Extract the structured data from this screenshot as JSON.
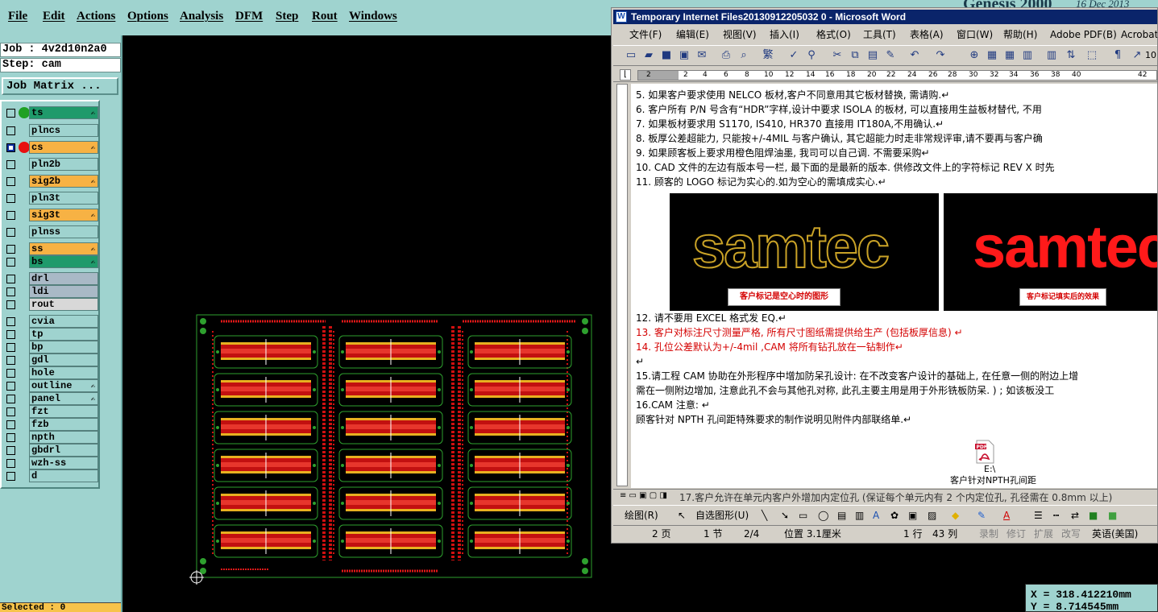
{
  "menubar": {
    "items": [
      "File",
      "Edit",
      "Actions",
      "Options",
      "Analysis",
      "DFM",
      "Step",
      "Rout",
      "Windows"
    ]
  },
  "genesis": {
    "title": "Genesis 2000",
    "date": "16 Dec 2013"
  },
  "panel": {
    "job": "Job : 4v2d10n2a0",
    "step": "Step: cam",
    "job_matrix": "Job Matrix ...",
    "layers": [
      {
        "name": "ts",
        "color": "#1f9a6b",
        "dot": "#1fa023",
        "checked": false,
        "edit": true
      },
      {
        "name": "plncs",
        "color": "#9fd3cf",
        "dot": "",
        "checked": false,
        "edit": false
      },
      {
        "name": "cs",
        "color": "#f7b244",
        "dot": "#e81010",
        "checked": true,
        "edit": true
      },
      {
        "name": "pln2b",
        "color": "#9fd3cf",
        "dot": "",
        "checked": false,
        "edit": false
      },
      {
        "name": "sig2b",
        "color": "#f7b244",
        "dot": "",
        "checked": false,
        "edit": true
      },
      {
        "name": "pln3t",
        "color": "#9fd3cf",
        "dot": "",
        "checked": false,
        "edit": false
      },
      {
        "name": "sig3t",
        "color": "#f7b244",
        "dot": "",
        "checked": false,
        "edit": true
      },
      {
        "name": "plnss",
        "color": "#9fd3cf",
        "dot": "",
        "checked": false,
        "edit": false
      },
      {
        "name": "ss",
        "color": "#f7b244",
        "dot": "",
        "checked": false,
        "edit": true
      },
      {
        "name": "bs",
        "color": "#1f9a6b",
        "dot": "",
        "checked": false,
        "edit": true
      },
      {
        "name": "drl",
        "color": "#a9b9c6",
        "dot": "",
        "checked": false,
        "edit": false
      },
      {
        "name": "ldi",
        "color": "#a9b9c6",
        "dot": "",
        "checked": false,
        "edit": false
      },
      {
        "name": "rout",
        "color": "#d8d8d8",
        "dot": "",
        "checked": false,
        "edit": false
      },
      {
        "name": "cvia",
        "color": "#9fd3cf",
        "dot": "",
        "checked": false,
        "edit": false
      },
      {
        "name": "tp",
        "color": "#9fd3cf",
        "dot": "",
        "checked": false,
        "edit": false
      },
      {
        "name": "bp",
        "color": "#9fd3cf",
        "dot": "",
        "checked": false,
        "edit": false
      },
      {
        "name": "gdl",
        "color": "#9fd3cf",
        "dot": "",
        "checked": false,
        "edit": false
      },
      {
        "name": "hole",
        "color": "#9fd3cf",
        "dot": "",
        "checked": false,
        "edit": false
      },
      {
        "name": "outline",
        "color": "#9fd3cf",
        "dot": "",
        "checked": false,
        "edit": true
      },
      {
        "name": "panel",
        "color": "#9fd3cf",
        "dot": "",
        "checked": false,
        "edit": true
      },
      {
        "name": "fzt",
        "color": "#9fd3cf",
        "dot": "",
        "checked": false,
        "edit": false
      },
      {
        "name": "fzb",
        "color": "#9fd3cf",
        "dot": "",
        "checked": false,
        "edit": false
      },
      {
        "name": "npth",
        "color": "#9fd3cf",
        "dot": "",
        "checked": false,
        "edit": false
      },
      {
        "name": "gbdrl",
        "color": "#9fd3cf",
        "dot": "",
        "checked": false,
        "edit": false
      },
      {
        "name": "wzh-ss",
        "color": "#9fd3cf",
        "dot": "",
        "checked": false,
        "edit": false
      },
      {
        "name": "d",
        "color": "#9fd3cf",
        "dot": "",
        "checked": false,
        "edit": false
      }
    ],
    "selected": "Selected : 0"
  },
  "coords": {
    "x": "X = 318.412210mm",
    "y": "Y = 8.714545mm"
  },
  "word": {
    "title": "Temporary Internet Files20130912205032 0 - Microsoft Word",
    "menu": [
      "文件(F)",
      "编辑(E)",
      "视图(V)",
      "插入(I)",
      "格式(O)",
      "工具(T)",
      "表格(A)",
      "窗口(W)",
      "帮助(H)",
      "Adobe PDF(B)",
      "Acrobat"
    ],
    "ruler_numbers": [
      "2",
      "2",
      "4",
      "6",
      "8",
      "10",
      "12",
      "14",
      "16",
      "18",
      "20",
      "22",
      "24",
      "26",
      "28",
      "30",
      "32",
      "34",
      "36",
      "38",
      "40",
      "42"
    ],
    "toolbar_zoom": "10",
    "lines": [
      {
        "text": "5.  如果客户要求使用 NELCO 板材,客户不同意用其它板材替换, 需请购.↵",
        "red": false
      },
      {
        "text": "6.  客户所有 P/N 号含有“HDR”字样,设计中要求 ISOLA 的板材, 可以直接用生益板材替代, 不用",
        "red": false
      },
      {
        "text": "7.  如果板材要求用 S1170, IS410, HR370 直接用 IT180A,不用确认.↵",
        "red": false
      },
      {
        "text": "8.  板厚公差超能力, 只能按+/-4MIL 与客户确认, 其它超能力时走非常规评审,请不要再与客户确",
        "red": false
      },
      {
        "text": "9.  如果顾客板上要求用橙色阻焊油墨, 我司可以自己调. 不需要采购↵",
        "red": false
      },
      {
        "text": "10.   CAD 文件的左边有版本号一栏, 最下面的是最新的版本. 供修改文件上的字符标记 REV X 时先",
        "red": false
      },
      {
        "text": "11.   顾客的 LOGO 标记为实心的.如为空心的需填成实心.↵",
        "red": false
      },
      {
        "text": "12.   请不要用 EXCEL 格式发 EQ.↵",
        "red": false
      },
      {
        "text": "13. 客户对标注尺寸测量严格, 所有尺寸图纸需提供给生产 (包括板厚信息) ↵",
        "red": true
      },
      {
        "text": "14. 孔位公差默认为+/-4mil  ,CAM 将所有钻孔放在一钻制作↵",
        "red": true
      },
      {
        "text": "↵",
        "red": false
      },
      {
        "text": "15.请工程 CAM 协助在外形程序中增加防呆孔设计: 在不改变客户设计的基础上, 在任意一侧的附边上增",
        "red": false
      },
      {
        "text": "需在一侧附边增加, 注意此孔不会与其他孔对称, 此孔主要主用是用于外形铣板防呆. ) ; 如该板没工",
        "red": false
      },
      {
        "text": "16.CAM 注意: ↵",
        "red": false
      },
      {
        "text": "    顾客针对 NPTH 孔间距特殊要求的制作说明见附件内部联络单.↵",
        "red": false
      }
    ],
    "logo_brand": "samtec",
    "logo_caption_left": "客户标记是空心时的图形",
    "logo_caption_right": "客户标记填实后的效果",
    "attachment_path": "E:\\",
    "attachment_name": "客户针对NPTH孔间距",
    "bottom_partial": "17.客户允许在单元内客户外增加内定位孔 (保证每个单元内有 2 个内定位孔, 孔径需在 0.8mm 以上)",
    "draw_label": "绘图(R)",
    "autoshape_label": "自选图形(U)",
    "status": {
      "page": "2 页",
      "section": "1 节",
      "pages": "2/4",
      "position": "位置 3.1厘米",
      "line": "1 行",
      "col": "43 列",
      "rec": "录制",
      "trk": "修订",
      "ext": "扩展",
      "ovr": "改写",
      "lang": "英语(美国)"
    }
  }
}
